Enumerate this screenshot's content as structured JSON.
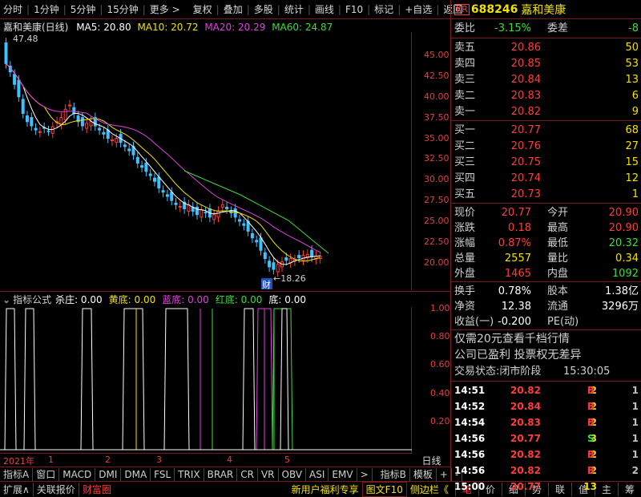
{
  "toolbar": {
    "left": [
      "分时",
      "1分钟",
      "5分钟",
      "15分钟",
      "更多 >"
    ],
    "right": [
      "复权",
      "叠加",
      "多股",
      "统计",
      "画线",
      "F10",
      "标记",
      "+自选",
      "返回"
    ]
  },
  "kline": {
    "name": "嘉和美康(日线)",
    "ma5": "MA5: 20.80",
    "ma10": "MA10: 20.72",
    "ma20": "MA20: 20.29",
    "ma60": "MA60: 24.87",
    "high_mark": "47.48",
    "low_mark": "←18.26",
    "cai": "财",
    "ylabels": [
      "45.00",
      "42.50",
      "40.00",
      "37.50",
      "35.00",
      "32.50",
      "30.00",
      "27.50",
      "25.00",
      "22.50",
      "20.00"
    ],
    "colors": {
      "up": "#ff3b3b",
      "down": "#40c0ff",
      "ma5": "#ffffff",
      "ma10": "#f0e000",
      "ma20": "#e040e0",
      "ma60": "#3bdc3b"
    }
  },
  "indicator": {
    "formula": "指标公式",
    "kill": "杀庄: 0.00",
    "yellow": "黄底: 0.00",
    "blue": "蓝底: 0.00",
    "red": "红底: 0.00",
    "bottom": "底: 0.00",
    "ylabels": [
      "1.00",
      "0.80",
      "0.60",
      "0.40",
      "0.20"
    ]
  },
  "dates": {
    "year": "2021年",
    "m1": "1",
    "m2": "2",
    "m3": "3",
    "m4": "4",
    "m5": "5"
  },
  "period_label": "日线",
  "tabs": [
    "指标A",
    "窗口",
    "MACD",
    "DMI",
    "DMA",
    "FSL",
    "TRIX",
    "BRAR",
    "CR",
    "VR",
    "OBV",
    "ASI",
    "EMV",
    ">",
    "指标B",
    "模板",
    "+",
    "-"
  ],
  "bottom": {
    "expand": "扩展∧",
    "link": "关联报价",
    "active": "财富圈",
    "promo": "新用户福利专享",
    "f10": "图文F10",
    "side": "侧边栏《"
  },
  "bottom_tabs": [
    "笔",
    "价",
    "细",
    "势",
    "联",
    "值",
    "主",
    "筹"
  ],
  "stock": {
    "badge": "KR",
    "code": "688246",
    "name": "嘉和美康"
  },
  "weibi": {
    "label": "委比",
    "value": "-3.15%",
    "label2": "委差",
    "value2": "-8"
  },
  "asks": [
    {
      "label": "卖五",
      "price": "20.86",
      "vol": "50"
    },
    {
      "label": "卖四",
      "price": "20.85",
      "vol": "53"
    },
    {
      "label": "卖三",
      "price": "20.84",
      "vol": "13"
    },
    {
      "label": "卖二",
      "price": "20.83",
      "vol": "6"
    },
    {
      "label": "卖一",
      "price": "20.82",
      "vol": "9"
    }
  ],
  "bids": [
    {
      "label": "买一",
      "price": "20.77",
      "vol": "68"
    },
    {
      "label": "买二",
      "price": "20.76",
      "vol": "27"
    },
    {
      "label": "买三",
      "price": "20.75",
      "vol": "15"
    },
    {
      "label": "买四",
      "price": "20.74",
      "vol": "12"
    },
    {
      "label": "买五",
      "price": "20.73",
      "vol": "1"
    }
  ],
  "quote": [
    {
      "l1": "现价",
      "v1": "20.77",
      "l2": "今开",
      "v2": "20.90"
    },
    {
      "l1": "涨跌",
      "v1": "0.18",
      "l2": "最高",
      "v2": "20.90"
    },
    {
      "l1": "涨幅",
      "v1": "0.87%",
      "l2": "最低",
      "v2": "20.32"
    },
    {
      "l1": "总量",
      "v1": "2557",
      "l2": "量比",
      "v2": "0.34"
    },
    {
      "l1": "外盘",
      "v1": "1465",
      "l2": "内盘",
      "v2": "1092"
    }
  ],
  "quote2": [
    {
      "l1": "换手",
      "v1": "0.78%",
      "l2": "股本",
      "v2": "1.38亿"
    },
    {
      "l1": "净资",
      "v1": "12.38",
      "l2": "流通",
      "v2": "3296万"
    },
    {
      "l1": "收益(一)",
      "v1": "-0.200",
      "l2": "PE(动)",
      "v2": ""
    }
  ],
  "notices": [
    "仅需20元查看千档行情",
    "公司已盈利 投票权无差异"
  ],
  "trade_status": {
    "label": "交易状态:",
    "value": "闭市阶段",
    "time": "15:30:05"
  },
  "ticks": [
    {
      "time": "14:51",
      "price": "20.82",
      "vol": "2",
      "bs": "B",
      "n": "1"
    },
    {
      "time": "14:52",
      "price": "20.84",
      "vol": "2",
      "bs": "B",
      "n": "1"
    },
    {
      "time": "14:54",
      "price": "20.83",
      "vol": "2",
      "bs": "B",
      "n": "1"
    },
    {
      "time": "14:56",
      "price": "20.77",
      "vol": "3",
      "bs": "S",
      "n": "1"
    },
    {
      "time": "14:56",
      "price": "20.82",
      "vol": "2",
      "bs": "B",
      "n": "1"
    },
    {
      "time": "14:56",
      "price": "20.82",
      "vol": "2",
      "bs": "B",
      "n": "2"
    },
    {
      "time": "15:00",
      "price": "20.77",
      "vol": "13",
      "bs": "",
      "n": ""
    }
  ]
}
